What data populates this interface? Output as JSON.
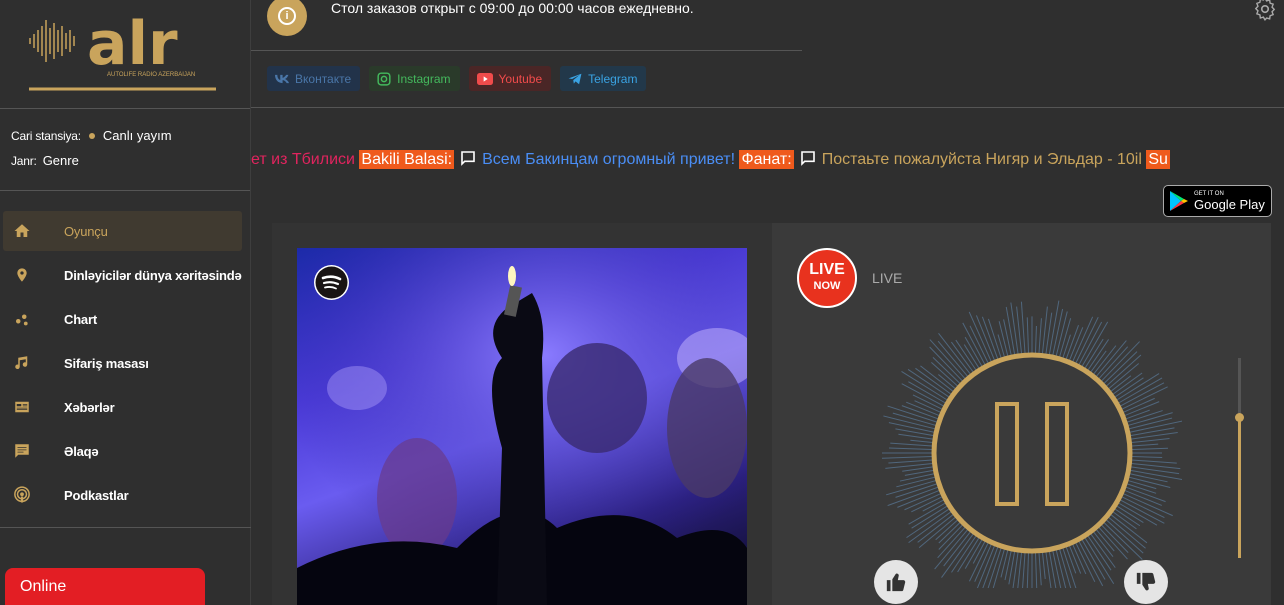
{
  "logo": {
    "brand": "alr",
    "tagline": "AUTOLIFE RADIO AZERBAIJAN"
  },
  "station": {
    "station_label": "Cari stansiya:",
    "station_value": "Canlı yayım",
    "genre_label": "Janr:",
    "genre_value": "Genre"
  },
  "nav": [
    {
      "label": "Oyunçu",
      "icon": "home-icon",
      "active": true
    },
    {
      "label": "Dinləyicilər dünya xəritəsində",
      "icon": "map-pin-icon"
    },
    {
      "label": "Chart",
      "icon": "chart-icon"
    },
    {
      "label": "Sifariş masası",
      "icon": "music-note-icon"
    },
    {
      "label": "Xəbərlər",
      "icon": "news-icon"
    },
    {
      "label": "Əlaqə",
      "icon": "message-icon"
    },
    {
      "label": "Podkastlar",
      "icon": "podcast-icon"
    }
  ],
  "online_label": "Online",
  "notice": "Стол заказов открыт с 09:00 до 00:00 часов ежедневно.",
  "socials": [
    {
      "label": "Вконтакте",
      "icon": "vk-icon"
    },
    {
      "label": "Instagram",
      "icon": "instagram-icon"
    },
    {
      "label": "Youtube",
      "icon": "youtube-icon"
    },
    {
      "label": "Telegram",
      "icon": "telegram-icon"
    }
  ],
  "ticker": {
    "part1": "ет из Тбилиси",
    "tag1": "Bakili Balasi:",
    "msg1": "Всем Бакинцам огромный привет!",
    "tag2": "Фанат:",
    "msg2": "Постаьте пожалуйста Нигяр и Эльдар - 10il",
    "tag3": "Su"
  },
  "google_play": {
    "small": "GET IT ON",
    "big": "Google Play"
  },
  "player": {
    "live_badge_line1": "LIVE",
    "live_badge_line2": "NOW",
    "live_text": "LIVE",
    "volume_fraction": 0.7
  },
  "colors": {
    "accent": "#c9a45c",
    "online": "#e31e24",
    "tag": "#ef5a1c"
  }
}
